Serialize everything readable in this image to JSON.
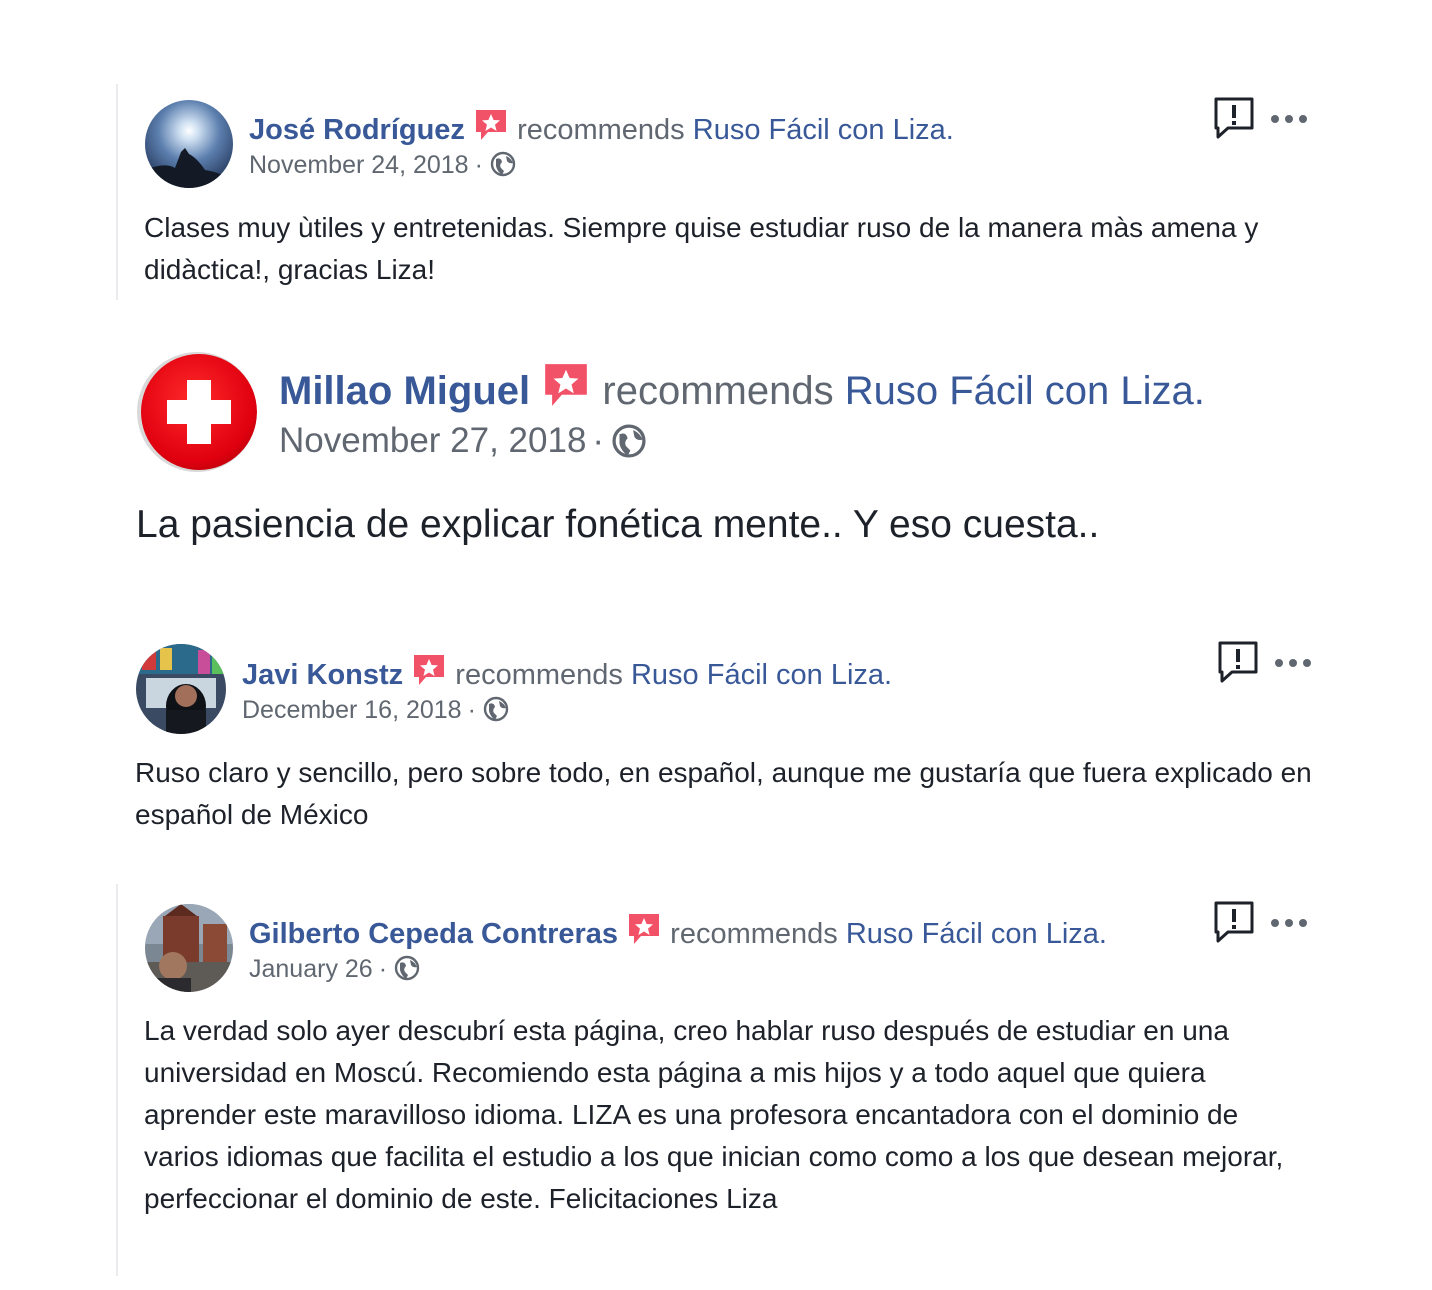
{
  "shared": {
    "recommends": "recommends",
    "page_name": "Ruso Fácil con Liza.",
    "separator": "·"
  },
  "reviews": [
    {
      "name": "José Rodríguez",
      "date": "November 24, 2018",
      "text": "Clases muy ùtiles y entretenidas. Siempre quise estudiar ruso de la manera màs amena y didàctica!, gracias Liza!"
    },
    {
      "name": "Millao Miguel",
      "date": "November 27, 2018",
      "text": "La pasiencia de explicar fonética mente.. Y eso cuesta.."
    },
    {
      "name": "Javi Konstz",
      "date": "December 16, 2018",
      "text": "Ruso claro y sencillo, pero sobre todo, en español, aunque me gustaría que fuera explicado en español de México"
    },
    {
      "name": "Gilberto Cepeda Contreras",
      "date": "January 26",
      "text": "La verdad solo ayer descubrí esta página, creo hablar ruso después de estudiar en una universidad en Moscú. Recomiendo esta página a mis hijos y a todo aquel que quiera aprender este maravilloso idioma. LIZA es una profesora encantadora con el dominio de varios idiomas que facilita el estudio a los que inician como como a los que desean mejorar, perfeccionar el dominio de este. Felicitaciones Liza"
    }
  ],
  "icons": {
    "badge": "recommendation-star-icon",
    "globe": "globe-icon",
    "report": "report-flag-icon",
    "more": "more-options-icon"
  },
  "colors": {
    "link": "#385898",
    "secondary": "#606770",
    "text": "#1d2129",
    "badge": "#f25268"
  }
}
